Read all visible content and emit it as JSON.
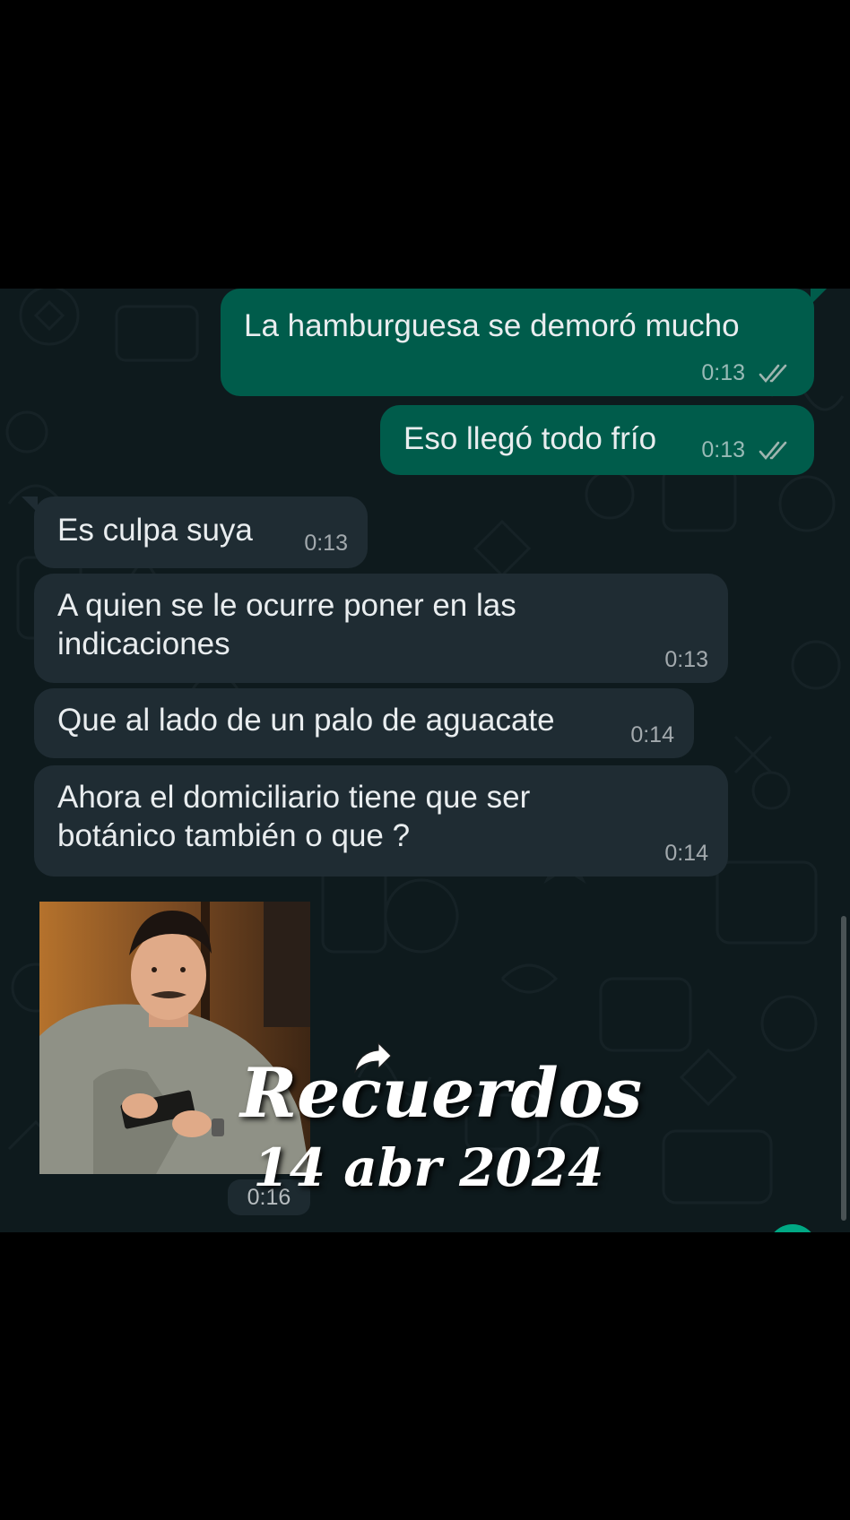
{
  "chat": {
    "messages": [
      {
        "direction": "out",
        "text": "La hamburguesa se demoró mucho",
        "time": "0:13",
        "status": "read"
      },
      {
        "direction": "out",
        "text": "Eso llegó todo frío",
        "time": "0:13",
        "status": "read"
      },
      {
        "direction": "in",
        "text": "Es culpa suya",
        "time": "0:13"
      },
      {
        "direction": "in",
        "text": "A quien se le ocurre poner en las\nindicaciones",
        "time": "0:13"
      },
      {
        "direction": "in",
        "text": "Que al lado de un palo de aguacate",
        "time": "0:14"
      },
      {
        "direction": "in",
        "text": "Ahora el domiciliario tiene que ser\nbotánico también o que ?",
        "time": "0:14"
      }
    ],
    "sticker": {
      "time": "0:16"
    }
  },
  "overlay": {
    "title": "Recuerdos",
    "date": "14 abr 2024"
  },
  "colors": {
    "background": "#000000",
    "chat_background": "#0e1a1d",
    "outgoing_bubble": "#005c4b",
    "incoming_bubble": "#1f2c33",
    "read_ticks": "#9fb5b0",
    "text": "#e9edef"
  },
  "icons": [
    "double-check-icon",
    "forward-arrow-icon"
  ]
}
